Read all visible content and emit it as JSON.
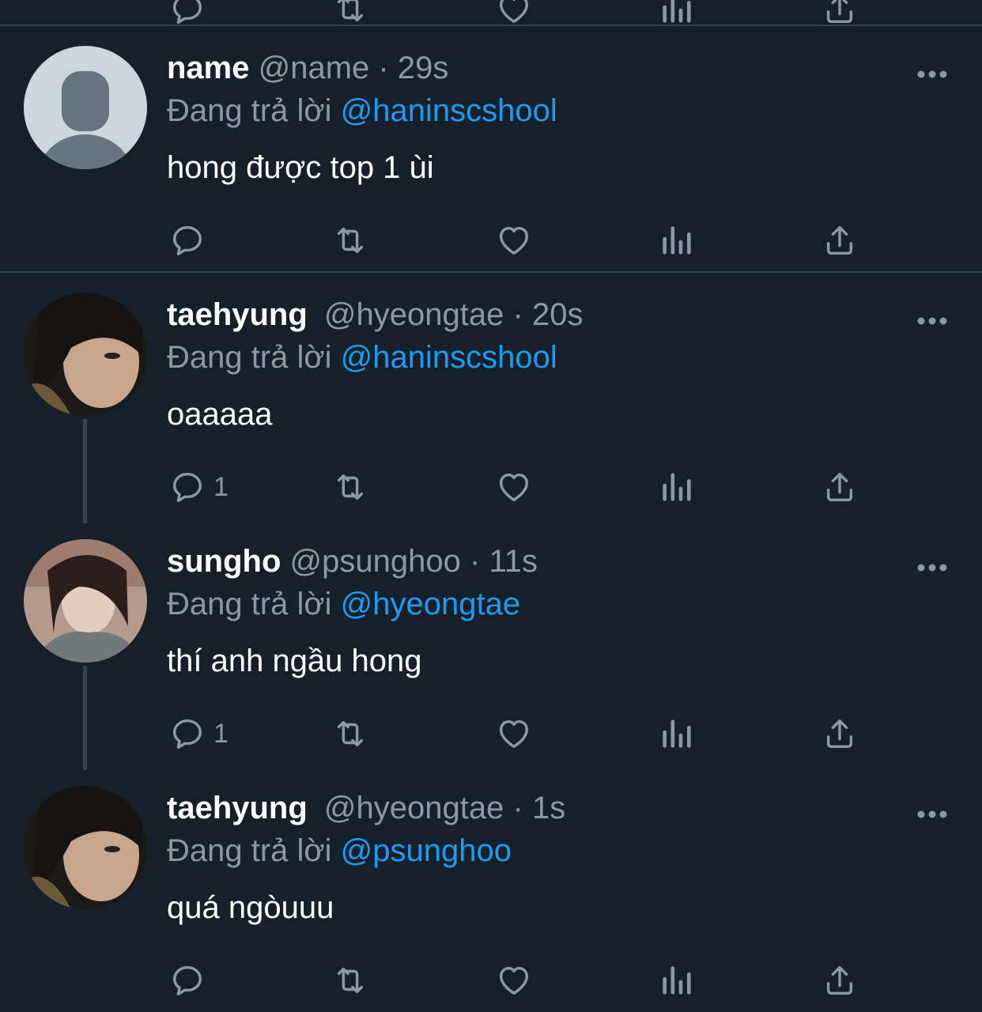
{
  "colors": {
    "background": "#15202b",
    "divider": "#38444d",
    "muted": "#8b98a5",
    "accent": "#1d9bf0",
    "text": "#ffffff"
  },
  "reply_prefix": "Đang trả lời",
  "icons": [
    "reply-icon",
    "retweet-icon",
    "like-icon",
    "views-icon",
    "share-icon",
    "more-icon"
  ],
  "tweets": [
    {
      "display_name": "name",
      "handle": "@name",
      "separator": "·",
      "time": "29s",
      "reply_to": "@haninscshool",
      "text": "hong được top 1 ùi",
      "reply_count": "",
      "avatar": "default-avatar"
    },
    {
      "display_name": "taehyung",
      "handle": "@hyeongtae",
      "separator": "·",
      "time": "20s",
      "reply_to": "@haninscshool",
      "text": "oaaaaa",
      "reply_count": "1",
      "avatar": "user-photo"
    },
    {
      "display_name": "sungho",
      "handle": "@psunghoo",
      "separator": "·",
      "time": "11s",
      "reply_to": "@hyeongtae",
      "text": "thí anh ngầu hong",
      "reply_count": "1",
      "avatar": "user-photo"
    },
    {
      "display_name": "taehyung",
      "handle": "@hyeongtae",
      "separator": "·",
      "time": "1s",
      "reply_to": "@psunghoo",
      "text": "quá ngòuuu",
      "reply_count": "",
      "avatar": "user-photo"
    }
  ]
}
